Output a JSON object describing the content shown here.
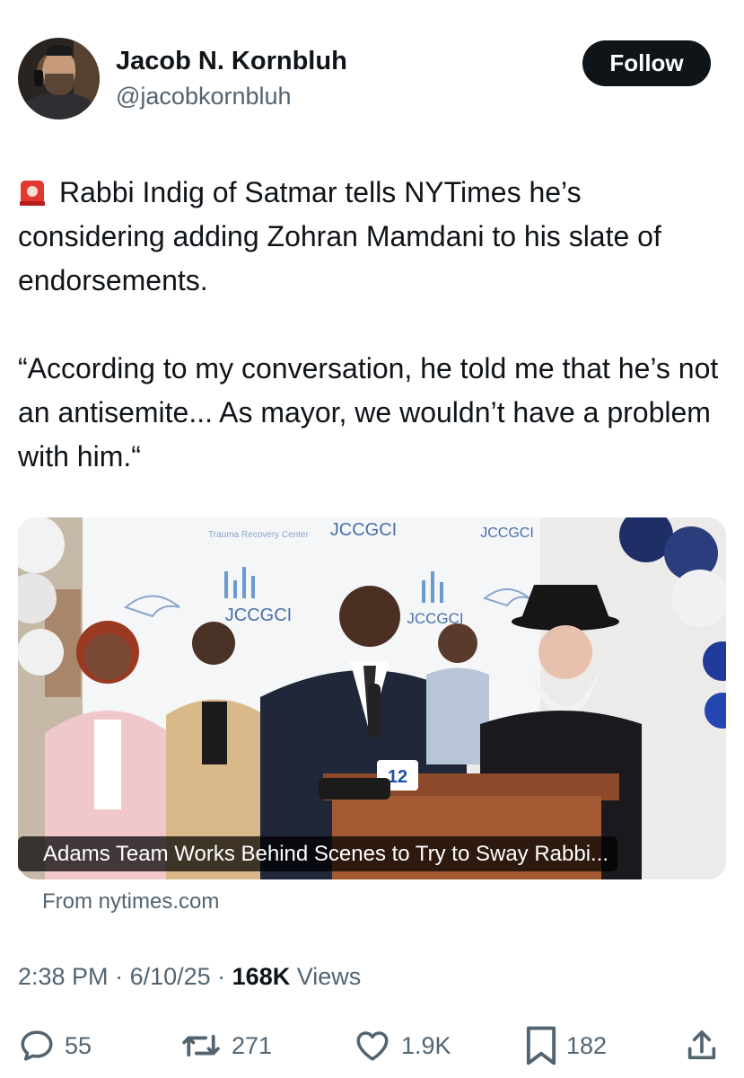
{
  "author": {
    "name": "Jacob N. Kornbluh",
    "handle": "@jacobkornbluh",
    "follow_label": "Follow"
  },
  "tweet": {
    "icon": "rotating-light-icon",
    "text": "Rabbi Indig of Satmar tells NYTimes he’s considering adding Zohran Mamdani to his slate of endorsements.\n\n“According to my conversation, he told me that he’s not an antisemite... As mayor, we wouldn’t have a problem with him.“"
  },
  "link_card": {
    "headline": "Adams Team Works Behind Scenes to Try to Sway Rabbi...",
    "source": "From nytimes.com",
    "backdrop_texts": [
      "JCCGCI",
      "Trauma Recovery Center"
    ],
    "mic_flag": "12"
  },
  "meta": {
    "time": "2:38 PM",
    "date": "6/10/25",
    "views": "168K",
    "views_label": "Views"
  },
  "actions": {
    "replies": "55",
    "reposts": "271",
    "likes": "1.9K",
    "bookmarks": "182"
  },
  "colors": {
    "text": "#0f1419",
    "secondary": "#536471",
    "button": "#0f1419"
  }
}
